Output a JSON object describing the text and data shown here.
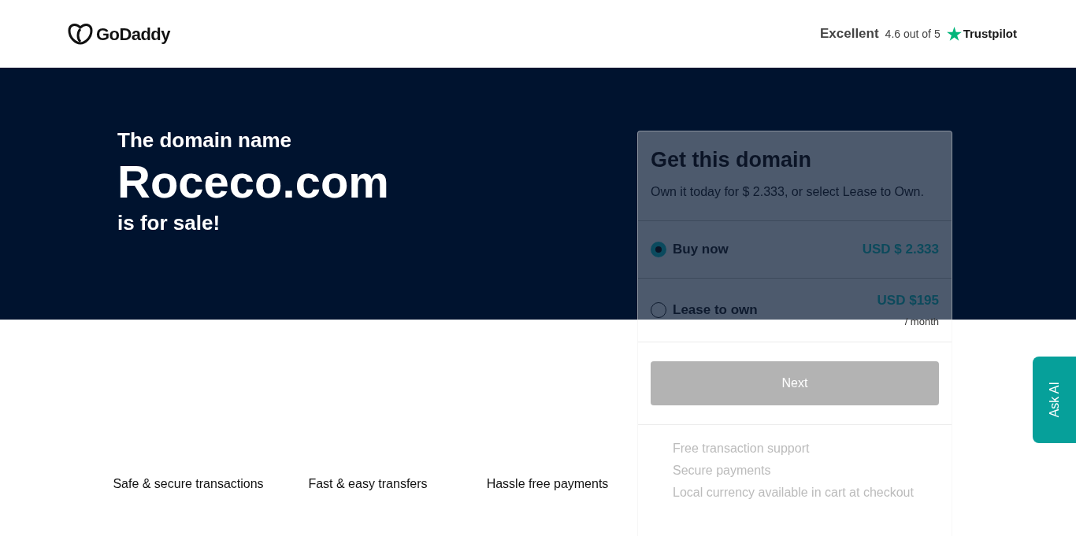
{
  "header": {
    "logo": "GoDaddy",
    "rating_label": "Excellent",
    "rating_text": "4.6 out of 5",
    "review_site": "Trustpilot"
  },
  "hero": {
    "intro": "The domain name",
    "domain": "Roceco.com",
    "outro": "is for sale!"
  },
  "features": [
    "Safe & secure transactions",
    "Fast & easy transfers",
    "Hassle free payments"
  ],
  "purchase_card": {
    "title": "Get this domain",
    "subtitle": "Own it today for $ 2.333, or select Lease to Own.",
    "options": [
      {
        "label": "Buy now",
        "price": "USD $ 2.333",
        "selected": true
      },
      {
        "label": "Lease to own",
        "price": "USD $195",
        "period": "/ month",
        "selected": false
      }
    ],
    "button": "Next",
    "button_disabled": true,
    "benefits": [
      "Free transaction support",
      "Secure payments",
      "Local currency available in cart at checkout"
    ]
  },
  "ask_ai": "Ask AI"
}
